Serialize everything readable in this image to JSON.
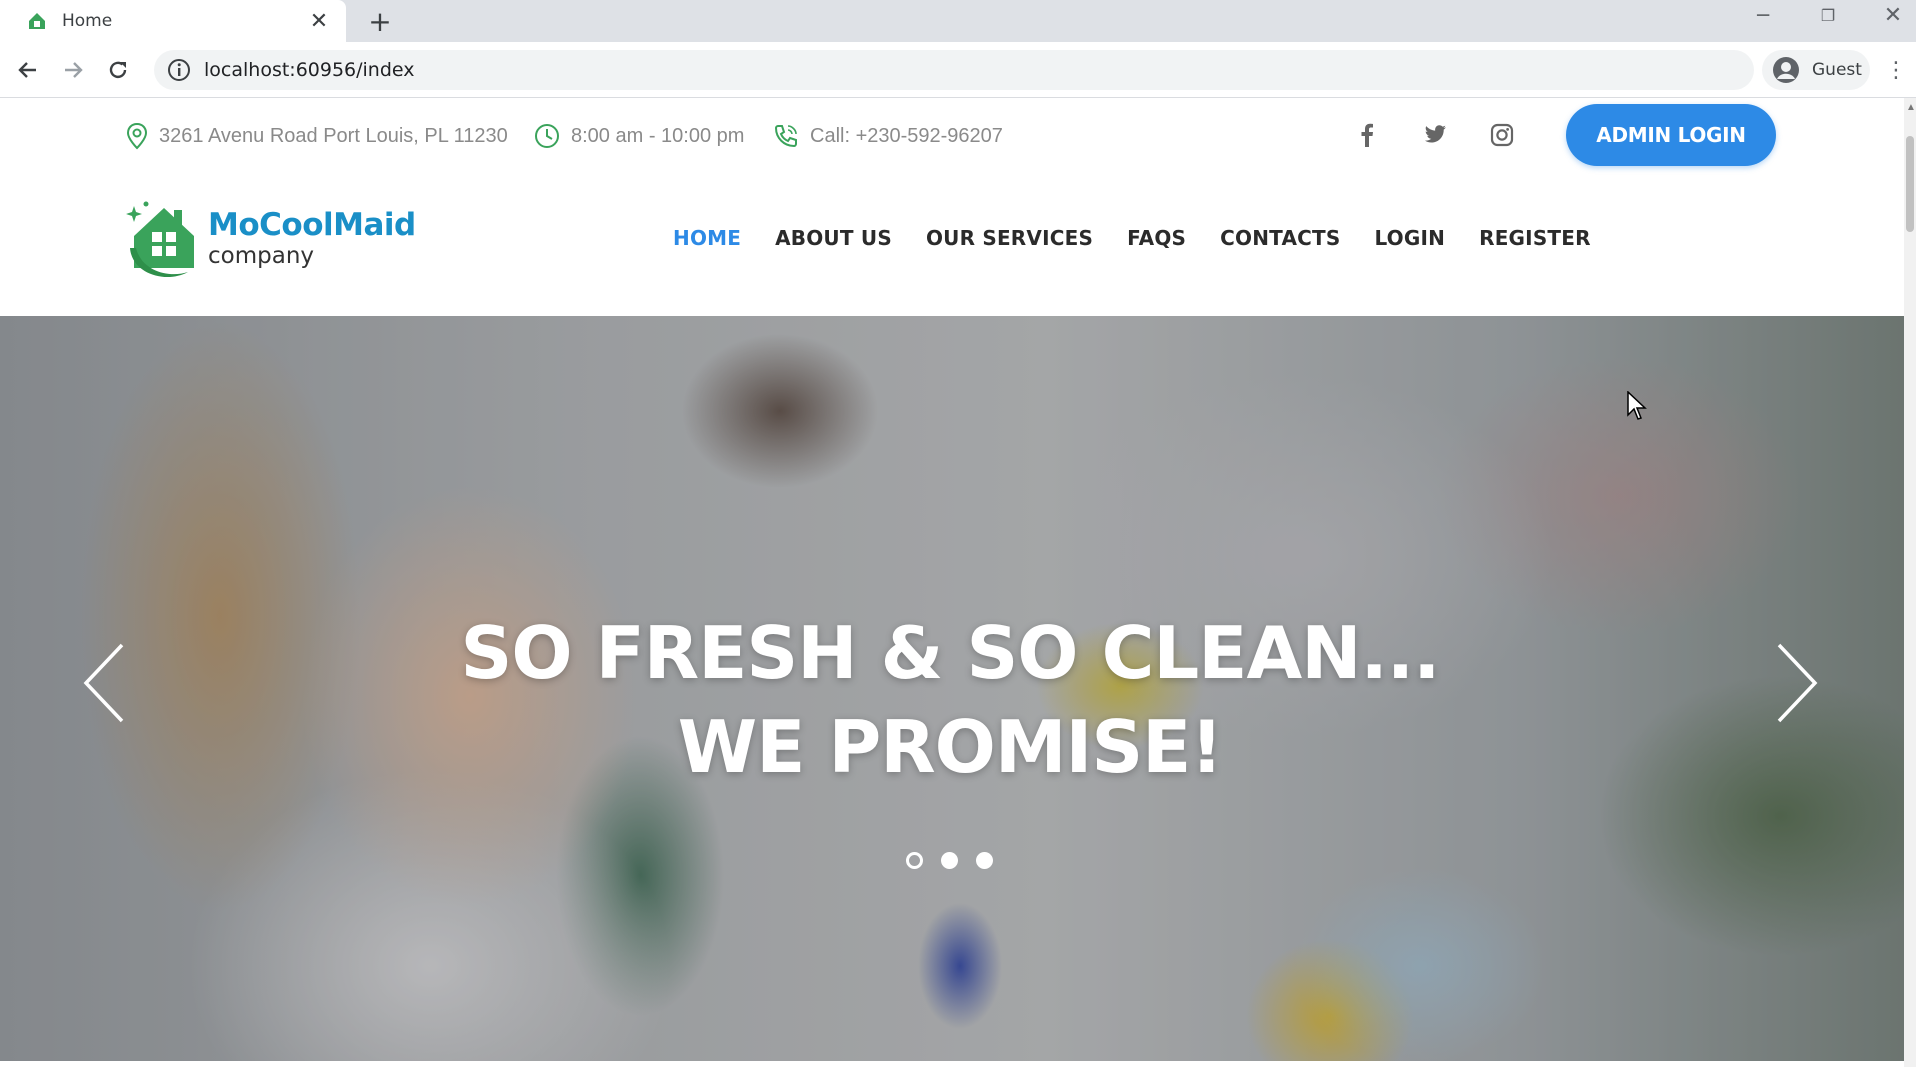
{
  "browser": {
    "tab_title": "Home",
    "url": "localhost:60956/index",
    "profile_label": "Guest"
  },
  "topbar": {
    "address": "3261 Avenu Road Port Louis, PL 11230",
    "hours": "8:00 am - 10:00 pm",
    "phone": "Call: +230-592-96207",
    "admin_login": "ADMIN LOGIN",
    "social_icons": [
      "facebook-icon",
      "twitter-icon",
      "instagram-icon"
    ]
  },
  "logo": {
    "name": "MoCoolMaid",
    "sub": "company"
  },
  "nav": {
    "items": [
      "HOME",
      "ABOUT US",
      "OUR SERVICES",
      "FAQS",
      "CONTACTS",
      "LOGIN",
      "REGISTER"
    ],
    "active": "HOME"
  },
  "hero": {
    "line1": "SO FRESH & SO CLEAN...",
    "line2": "WE PROMISE!",
    "slide_count": 3,
    "active_slide": 1
  },
  "colors": {
    "accent": "#2d8ae6",
    "logo_blue": "#1a8fc7",
    "logo_green": "#3aa35b"
  }
}
